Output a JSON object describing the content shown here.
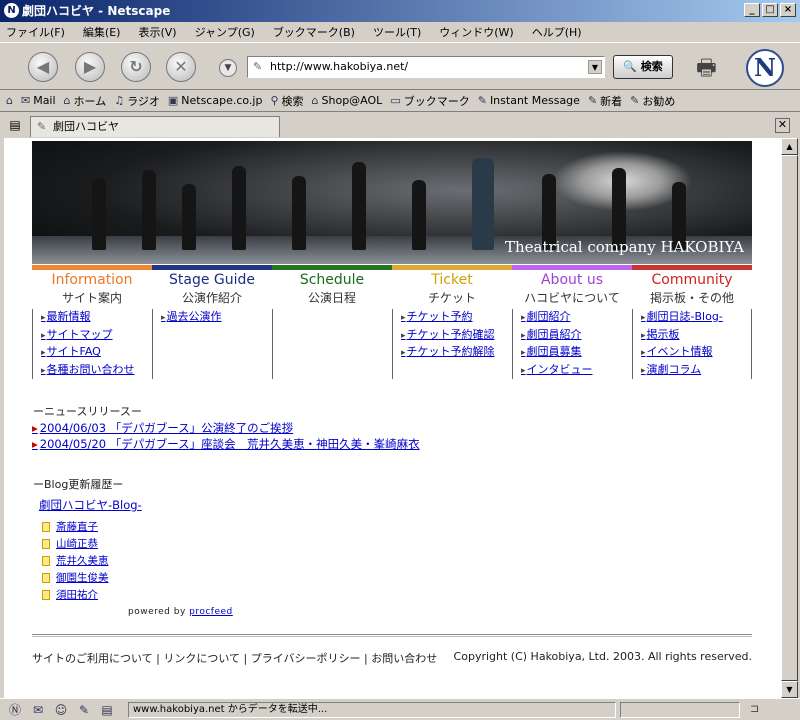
{
  "window": {
    "title": "劇団ハコビヤ - Netscape",
    "buttons": [
      "_",
      "□",
      "×"
    ]
  },
  "menu": [
    "ファイル(F)",
    "編集(E)",
    "表示(V)",
    "ジャンプ(G)",
    "ブックマーク(B)",
    "ツール(T)",
    "ウィンドウ(W)",
    "ヘルプ(H)"
  ],
  "toolbar": {
    "url": "http://www.hakobiya.net/",
    "search_label": "検索"
  },
  "personal_toolbar": [
    {
      "icon": "mail-icon",
      "label": "Mail"
    },
    {
      "icon": "home-icon",
      "label": "ホーム"
    },
    {
      "icon": "radio-icon",
      "label": "ラジオ"
    },
    {
      "icon": "my-icon",
      "label": "Netscape.co.jp"
    },
    {
      "icon": "search-icon",
      "label": "検索"
    },
    {
      "icon": "shop-icon",
      "label": "Shop@AOL"
    },
    {
      "icon": "bookmark-icon",
      "label": "ブックマーク"
    },
    {
      "icon": "link-icon",
      "label": "Instant Message"
    },
    {
      "icon": "link-icon",
      "label": "新着"
    },
    {
      "icon": "link-icon",
      "label": "お勧め"
    }
  ],
  "tab": {
    "label": "劇団ハコビヤ"
  },
  "banner": {
    "title": "Theatrical company HAKOBIYA"
  },
  "nav": [
    {
      "en": "Information",
      "jp": "サイト案内",
      "color": "#ee7722",
      "bar": "#ee8833",
      "links": [
        "最新情報",
        "サイトマップ",
        "サイトFAQ",
        "各種お問い合わせ"
      ]
    },
    {
      "en": "Stage Guide",
      "jp": "公演作紹介",
      "color": "#1a2f80",
      "bar": "#223388",
      "links": [
        "過去公演作"
      ]
    },
    {
      "en": "Schedule",
      "jp": "公演日程",
      "color": "#1a6a1a",
      "bar": "#227722",
      "links": []
    },
    {
      "en": "Ticket",
      "jp": "チケット",
      "color": "#d4a000",
      "bar": "#ddaa33",
      "links": [
        "チケット予約",
        "チケット予約確認",
        "チケット予約解除"
      ]
    },
    {
      "en": "About us",
      "jp": "ハコビヤについて",
      "color": "#a040d8",
      "bar": "#bb66ee",
      "links": [
        "劇団紹介",
        "劇団員紹介",
        "劇団員募集",
        "インタビュー"
      ]
    },
    {
      "en": "Community",
      "jp": "掲示板・その他",
      "color": "#cc2222",
      "bar": "#cc3333",
      "links": [
        "劇団日誌-Blog-",
        "掲示板",
        "イベント情報",
        "演劇コラム"
      ]
    }
  ],
  "news": {
    "heading": "ーニュースリリースー",
    "items": [
      "2004/06/03 「デパガブース」公演終了のご挨拶",
      "2004/05/20 「デパガブース」座談会　荒井久美恵・神田久美・峯崎麻衣"
    ]
  },
  "blog": {
    "heading": "ーBlog更新履歴ー",
    "title": "劇団ハコビヤ-Blog-",
    "entries": [
      "斎藤直子",
      "山崎正恭",
      "荒井久美恵",
      "御園生俊美",
      "須田祐介"
    ],
    "powered_prefix": "powered by ",
    "powered_link": "procfeed"
  },
  "footer": {
    "links": "サイトのご利用について | リンクについて | プライバシーポリシー | お問い合わせ",
    "copyright": "Copyright (C) Hakobiya, Ltd. 2003. All rights reserved."
  },
  "status": {
    "message": "www.hakobiya.net からデータを転送中..."
  }
}
